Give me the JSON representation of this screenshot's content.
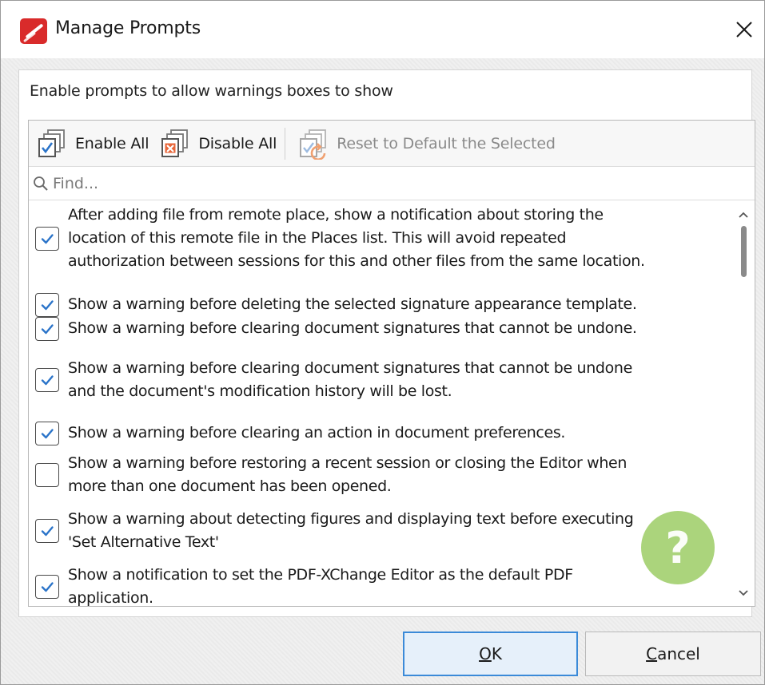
{
  "window": {
    "title": "Manage Prompts",
    "app_icon": "pdf-xchange-logo-icon",
    "close_icon": "close-icon"
  },
  "group": {
    "title": "Enable prompts to allow warnings boxes to show"
  },
  "toolbar": {
    "enable_all": "Enable All",
    "disable_all": "Disable All",
    "reset": "Reset to Default the Selected"
  },
  "find": {
    "placeholder": "Find..."
  },
  "prompts": [
    {
      "checked": true,
      "lines": [
        "After adding file from remote place, show a notification about storing the",
        "location of this remote file in the Places list.  This will avoid repeated",
        "authorization between sessions for this and other files from the same location."
      ]
    },
    {
      "checked": true,
      "lines": [
        "Show a warning before deleting the selected signature appearance template."
      ]
    },
    {
      "checked": true,
      "lines": [
        "Show a warning before clearing document signatures that cannot be undone."
      ]
    },
    {
      "checked": true,
      "lines": [
        "Show a warning before clearing document signatures that cannot be undone",
        "and the document's modification history will be lost."
      ]
    },
    {
      "checked": true,
      "lines": [
        "Show a warning before clearing an action in document preferences."
      ]
    },
    {
      "checked": false,
      "lines": [
        "Show a warning before restoring a recent session or closing the Editor when",
        "more than one document has been opened."
      ]
    },
    {
      "checked": true,
      "lines": [
        "Show a warning about detecting figures and displaying text before executing",
        "'Set Alternative Text'"
      ]
    },
    {
      "checked": true,
      "lines": [
        "Show a notification to set the PDF-XChange Editor as the default PDF",
        "application."
      ]
    }
  ],
  "help": {
    "glyph": "?"
  },
  "buttons": {
    "ok_mnemonic": "O",
    "ok_rest": "K",
    "cancel_mnemonic": "C",
    "cancel_rest": "ancel"
  },
  "colors": {
    "accent": "#3b8ad8",
    "checkmark": "#2b74c9",
    "help": "#8bc34a",
    "app_icon": "#d92b2b"
  }
}
